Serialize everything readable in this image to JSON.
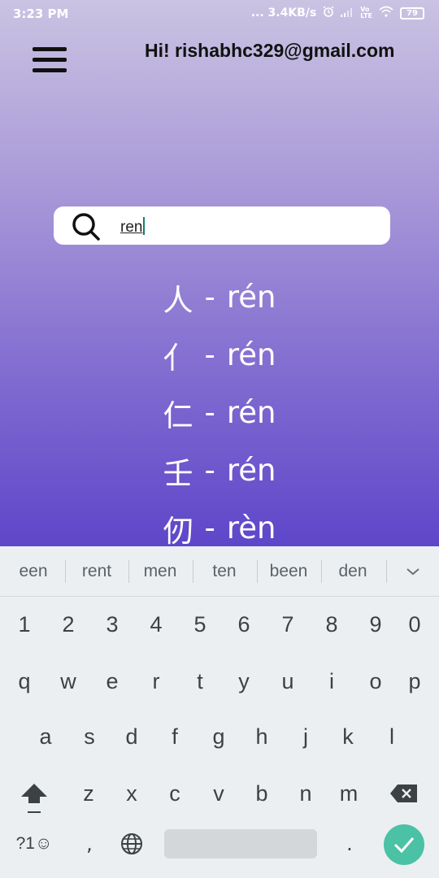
{
  "status_bar": {
    "time": "3:23 PM",
    "network_speed": "... 3.4KB/s",
    "volte_label": "Vo\nLTE",
    "battery": "79",
    "icons": [
      "alarm-icon",
      "signal-icon",
      "volte-icon",
      "wifi-icon",
      "battery-icon"
    ]
  },
  "header": {
    "menu_icon": "hamburger-menu-icon",
    "greeting": "Hi! rishabhc329@gmail.com"
  },
  "search": {
    "icon": "search-icon",
    "value": "ren"
  },
  "results": [
    {
      "character": "人",
      "separator": "-",
      "pinyin": "rén"
    },
    {
      "character": "亻",
      "separator": "-",
      "pinyin": "rén"
    },
    {
      "character": "仁",
      "separator": "-",
      "pinyin": "rén"
    },
    {
      "character": "壬",
      "separator": "-",
      "pinyin": "rén"
    },
    {
      "character": "仞",
      "separator": "-",
      "pinyin": "rèn"
    }
  ],
  "keyboard": {
    "suggestions": [
      "een",
      "rent",
      "men",
      "ten",
      "been",
      "den"
    ],
    "number_row": [
      "1",
      "2",
      "3",
      "4",
      "5",
      "6",
      "7",
      "8",
      "9",
      "0"
    ],
    "row1": [
      "q",
      "w",
      "e",
      "r",
      "t",
      "y",
      "u",
      "i",
      "o",
      "p"
    ],
    "row2": [
      "a",
      "s",
      "d",
      "f",
      "g",
      "h",
      "j",
      "k",
      "l"
    ],
    "row3": [
      "z",
      "x",
      "c",
      "v",
      "b",
      "n",
      "m"
    ],
    "symbols_label": "?1☺",
    "comma": ",",
    "period": ".",
    "accent_color": "#4bc1a5"
  },
  "colors": {
    "gradient_top": "#cac3e2",
    "gradient_bottom": "#5e46c9",
    "keyboard_bg": "#eceff1"
  }
}
